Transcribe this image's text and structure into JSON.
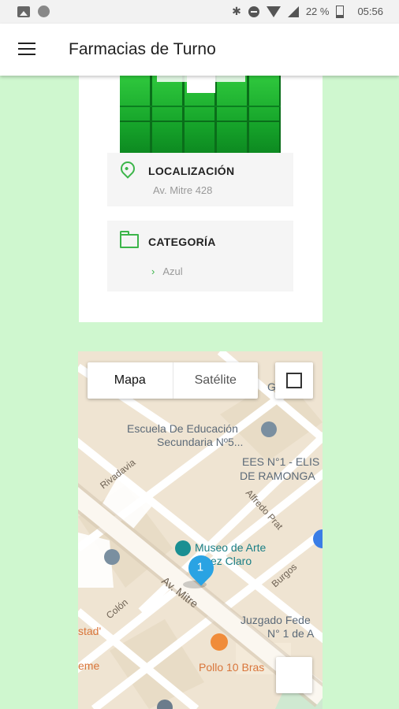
{
  "status_bar": {
    "battery": "22 %",
    "time": "05:56"
  },
  "app_bar": {
    "title": "Farmacias de Turno"
  },
  "card": {
    "location": {
      "label": "LOCALIZACIÓN",
      "address": "Av. Mitre 428"
    },
    "category": {
      "label": "CATEGORÍA",
      "item": "Azul"
    }
  },
  "map": {
    "map_type_options": [
      "Mapa",
      "Satélite"
    ],
    "selected_map_type": "Mapa",
    "marker_label": "1",
    "labels": {
      "school": "Escuela De Educación",
      "school2": "Secundaria Nº5...",
      "ees1": "EES N°1 - ELIS",
      "ees2": "DE RAMONGA",
      "museum1": "Museo de Arte",
      "museum2": "ez Claro",
      "court1": "Juzgado Fede",
      "court2": "N° 1 de A",
      "pollo": "Pollo 10 Bras",
      "top_right": "G   o M",
      "street_rivadavia": "Rivadavia",
      "street_alfredo": "Alfredo Prat",
      "street_burgos": "Burgos",
      "street_colon": "Colón",
      "street_mitre": "Av. Mitre",
      "edge_stad": "stad'",
      "edge_eme": "eme"
    }
  },
  "colors": {
    "accent": "#3cb54a",
    "background": "#cff7cf",
    "marker": "#2aa3e3"
  }
}
